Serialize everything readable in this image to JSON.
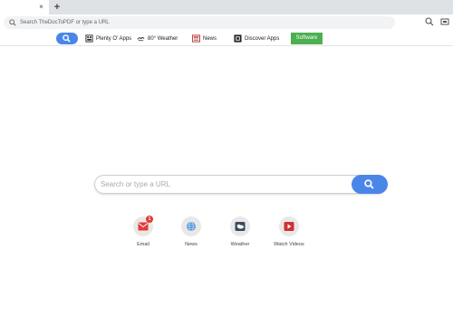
{
  "browser": {
    "tab_close_glyph": "×",
    "new_tab_glyph": "+",
    "omnibox_placeholder": "Search TheDocToPDF or type a URL"
  },
  "extension_bar": {
    "items": [
      {
        "label": "Plenty O' Apps",
        "icon": "apps-icon"
      },
      {
        "label": "80° Weather",
        "icon": "weather-icon"
      },
      {
        "label": "News",
        "icon": "news-icon"
      },
      {
        "label": "Discover Apps",
        "icon": "discover-apps-icon"
      }
    ],
    "software_label": "Software",
    "software_color": "#4caf50",
    "search_button_color": "#4a86e8"
  },
  "main": {
    "search_placeholder": "Search or type a URL",
    "search_button_color": "#4a86e8",
    "shortcuts": [
      {
        "label": "Email",
        "icon": "email-icon",
        "badge": "1"
      },
      {
        "label": "News",
        "icon": "globe-icon"
      },
      {
        "label": "Weather",
        "icon": "weather-icon"
      },
      {
        "label": "Watch Videos",
        "icon": "video-play-icon"
      }
    ]
  }
}
